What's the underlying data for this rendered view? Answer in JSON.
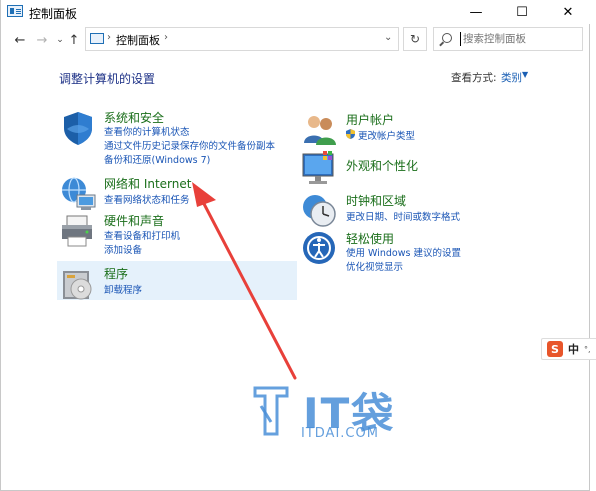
{
  "window": {
    "title": "控制面板",
    "minimize_glyph": "—",
    "maximize_glyph": "☐",
    "close_glyph": "✕"
  },
  "nav": {
    "back_glyph": "←",
    "forward_glyph": "→",
    "recent_glyph": "⌄",
    "up_glyph": "↑",
    "refresh_glyph": "↻"
  },
  "address": {
    "separator": "›",
    "path": "控制面板",
    "dropdown_glyph": "⌄"
  },
  "search": {
    "placeholder": "搜索控制面板"
  },
  "content": {
    "heading": "调整计算机的设置",
    "view_by_label": "查看方式:",
    "view_by_value": "类别",
    "view_by_arrow": "▼"
  },
  "categories": {
    "system_security": {
      "title": "系统和安全",
      "links": [
        "查看你的计算机状态",
        "通过文件历史记录保存你的文件备份副本",
        "备份和还原(Windows 7)"
      ]
    },
    "network": {
      "title": "网络和 Internet",
      "links": [
        "查看网络状态和任务"
      ]
    },
    "hardware": {
      "title": "硬件和声音",
      "links": [
        "查看设备和打印机",
        "添加设备"
      ]
    },
    "programs": {
      "title": "程序",
      "links": [
        "卸载程序"
      ]
    },
    "user_accounts": {
      "title": "用户帐户",
      "links": [
        "更改帐户类型"
      ]
    },
    "appearance": {
      "title": "外观和个性化",
      "links": []
    },
    "clock_region": {
      "title": "时钟和区域",
      "links": [
        "更改日期、时间或数字格式"
      ]
    },
    "ease_of_access": {
      "title": "轻松使用",
      "links": [
        "使用 Windows 建议的设置",
        "优化视觉显示"
      ]
    }
  },
  "ime": {
    "logo": "S",
    "mode": "中",
    "dot": "°,"
  },
  "watermark": {
    "brand": "IT袋",
    "site": "ITDAI.COM"
  },
  "colors": {
    "accent_link": "#1a55b5",
    "category_title": "#1a6e1a",
    "heading": "#1e3287",
    "arrow": "#e8403a",
    "watermark": "#4a8fd8",
    "hover_highlight": "#e5f1fb"
  }
}
